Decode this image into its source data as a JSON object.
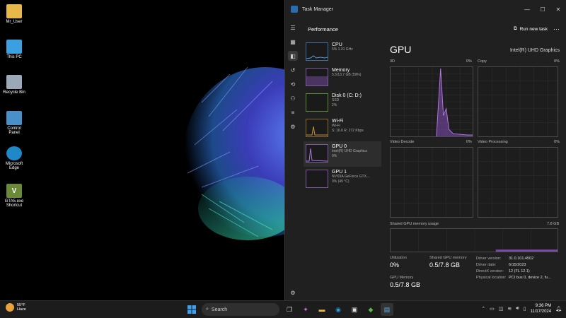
{
  "desktop": {
    "icons": [
      {
        "label": "Mr_User",
        "icon": "folder-icon",
        "color": "#e8b84a"
      },
      {
        "label": "This PC",
        "icon": "monitor-icon",
        "color": "#3aa0e0"
      },
      {
        "label": "Recycle Bin",
        "icon": "recycle-bin-icon",
        "color": "#9aa8b8"
      },
      {
        "label": "Control Panel",
        "icon": "control-panel-icon",
        "color": "#4a90c8"
      },
      {
        "label": "Microsoft Edge",
        "icon": "edge-icon",
        "color": "#1e88c8"
      },
      {
        "label": "GTA5.exe Shortcut",
        "icon": "gta-icon",
        "color": "#6a8a3a"
      }
    ]
  },
  "task_manager": {
    "window_title": "Task Manager",
    "page_title": "Performance",
    "run_task_label": "Run new task",
    "more_label": "···",
    "devices": [
      {
        "name": "CPU",
        "sub1": "5% 1.31 GHz",
        "sub2": "",
        "accent": "#3f6fa0"
      },
      {
        "name": "Memory",
        "sub1": "5.5/13.7 GB (59%)",
        "sub2": "",
        "accent": "#7a5a9a"
      },
      {
        "name": "Disk 0 (C: D:)",
        "sub1": "SSD",
        "sub2": "2%",
        "accent": "#5b8a3a"
      },
      {
        "name": "Wi-Fi",
        "sub1": "Wi-Fi",
        "sub2": "S: 16.0 R: 272 Kbps",
        "accent": "#8a6a30"
      },
      {
        "name": "GPU 0",
        "sub1": "Intel(R) UHD Graphics",
        "sub2": "0%",
        "accent": "#7a5a9a"
      },
      {
        "name": "GPU 1",
        "sub1": "NVIDIA GeForce GTX...",
        "sub2": "0% (49 °C)",
        "accent": "#7a5a9a"
      }
    ],
    "gpu": {
      "title": "GPU",
      "model": "Intel(R) UHD Graphics",
      "graphs": [
        {
          "name": "3D",
          "pct": "0%"
        },
        {
          "name": "Copy",
          "pct": "0%"
        },
        {
          "name": "Video Decode",
          "pct": "0%"
        },
        {
          "name": "Video Processing",
          "pct": "0%"
        }
      ],
      "shared_label": "Shared GPU memory usage",
      "shared_max": "7.8 GB",
      "stats": {
        "utilization_label": "Utilization",
        "utilization_value": "0%",
        "shared_mem_label": "Shared GPU memory",
        "shared_mem_value": "0.5/7.8 GB",
        "gpu_mem_label": "GPU Memory",
        "gpu_mem_value": "0.5/7.8 GB"
      },
      "properties": [
        {
          "label": "Driver version:",
          "value": "31.0.101.4502"
        },
        {
          "label": "Driver date:",
          "value": "6/15/2023"
        },
        {
          "label": "DirectX version:",
          "value": "12 (FL 12.1)"
        },
        {
          "label": "Physical location:",
          "value": "PCI bus 0, device 2, fu..."
        }
      ]
    }
  },
  "taskbar": {
    "weather_temp": "55°F",
    "weather_desc": "Haze",
    "search_placeholder": "Search",
    "time": "9:36 PM",
    "date": "11/17/2024"
  }
}
